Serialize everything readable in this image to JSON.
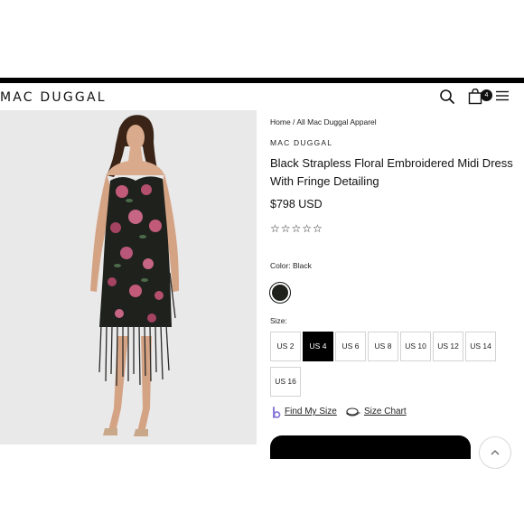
{
  "header": {
    "logo": "MAC DUGGAL",
    "icons": [
      "search-icon",
      "shopping-bag-icon",
      "hamburger-menu-icon"
    ],
    "bag_count": "4"
  },
  "product": {
    "breadcrumb": [
      "Home",
      " / ",
      "All Mac Duggal Apparel"
    ],
    "brand": "MAC DUGGAL",
    "title": "Black Strapless Floral Embroidered Midi Dress With Fringe Detailing",
    "price": "$798 USD",
    "rating_stars": "☆☆☆☆☆",
    "color_label": "Color: Black",
    "size_label": "Size:",
    "sizes": [
      "US 2",
      "US 4",
      "US 6",
      "US 8",
      "US 10",
      "US 12",
      "US 14",
      "US 16"
    ],
    "selected_size": "US 4",
    "find_my_size": "Find My Size",
    "size_chart": "Size Chart"
  },
  "colors": {
    "accent": "#000000",
    "swatch": "#1e211c",
    "image_bg": "#e9e9ea"
  }
}
